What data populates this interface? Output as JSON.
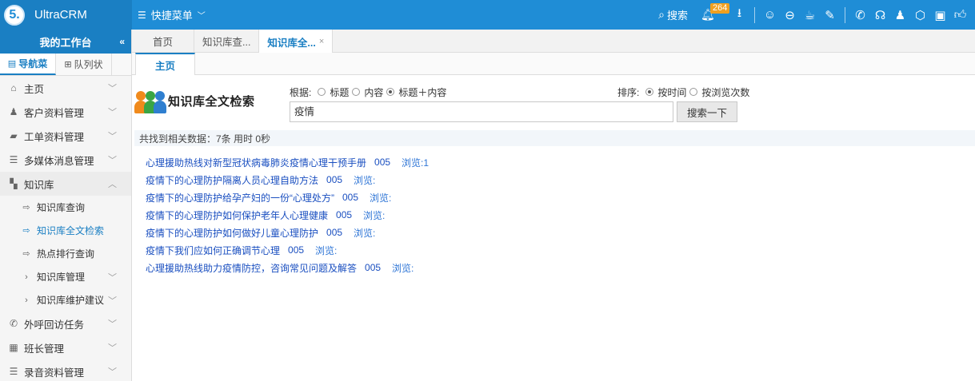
{
  "app": {
    "logo_text": "5.",
    "name": "UltraCRM"
  },
  "topbar": {
    "quick_menu_label": "快捷菜单",
    "search_label": "搜索",
    "notification_count": "264",
    "icons": [
      "bell-icon",
      "download-icon",
      "user-icon",
      "minus-circle-icon",
      "cup-icon",
      "edit-icon",
      "phone-icon",
      "headset-icon",
      "group-icon",
      "shield-icon",
      "chart-icon",
      "thumbs-up-icon"
    ]
  },
  "sidebar": {
    "title": "我的工作台",
    "tabs": [
      {
        "label": "导航菜",
        "active": true
      },
      {
        "label": "队列状",
        "active": false
      }
    ],
    "items": [
      {
        "label": "主页",
        "icon": "home-icon"
      },
      {
        "label": "客户资料管理",
        "icon": "user-icon"
      },
      {
        "label": "工单资料管理",
        "icon": "briefcase-icon"
      },
      {
        "label": "多媒体消息管理",
        "icon": "list-icon"
      },
      {
        "label": "知识库",
        "icon": "map-icon",
        "open": true
      }
    ],
    "knowledge_sub": [
      {
        "label": "知识库查询",
        "active": false
      },
      {
        "label": "知识库全文检索",
        "active": true
      },
      {
        "label": "热点排行查询",
        "active": false
      },
      {
        "label": "知识库管理",
        "active": false
      },
      {
        "label": "知识库维护建议",
        "active": false
      }
    ],
    "items_after": [
      {
        "label": "外呼回访任务",
        "icon": "phone-icon"
      },
      {
        "label": "班长管理",
        "icon": "grid-icon"
      },
      {
        "label": "录音资料管理",
        "icon": "list-icon"
      }
    ]
  },
  "page_tabs": [
    {
      "label": "首页",
      "active": false
    },
    {
      "label": "知识库查...",
      "active": false
    },
    {
      "label": "知识库全...",
      "active": true,
      "close": "×"
    }
  ],
  "sub_tab": "主页",
  "search": {
    "title": "知识库全文检索",
    "basis_label": "根据:",
    "basis_options": [
      {
        "label": "标题",
        "selected": false
      },
      {
        "label": "内容",
        "selected": false
      },
      {
        "label": "标题＋内容",
        "selected": true
      }
    ],
    "sort_label": "排序:",
    "sort_options": [
      {
        "label": "按时间",
        "selected": true
      },
      {
        "label": "按浏览次数",
        "selected": false
      }
    ],
    "query": "疫情",
    "button_label": "搜索一下"
  },
  "result_summary": "共找到相关数据：7条 用时 0秒",
  "results": [
    {
      "title": "心理援助热线对新型冠状病毒肺炎疫情心理干预手册",
      "num": "005",
      "views": "浏览:1"
    },
    {
      "title": "疫情下的心理防护隔离人员心理自助方法",
      "num": "005",
      "views": "浏览:"
    },
    {
      "title": "疫情下的心理防护给孕产妇的一份“心理处方”",
      "num": "005",
      "views": "浏览:"
    },
    {
      "title": "疫情下的心理防护如何保护老年人心理健康",
      "num": "005",
      "views": "浏览:"
    },
    {
      "title": "疫情下的心理防护如何做好儿童心理防护",
      "num": "005",
      "views": "浏览:"
    },
    {
      "title": "疫情下我们应如何正确调节心理",
      "num": "005",
      "views": "浏览:"
    },
    {
      "title": "心理援助热线助力疫情防控，咨询常见问题及解答",
      "num": "005",
      "views": "浏览:"
    }
  ]
}
